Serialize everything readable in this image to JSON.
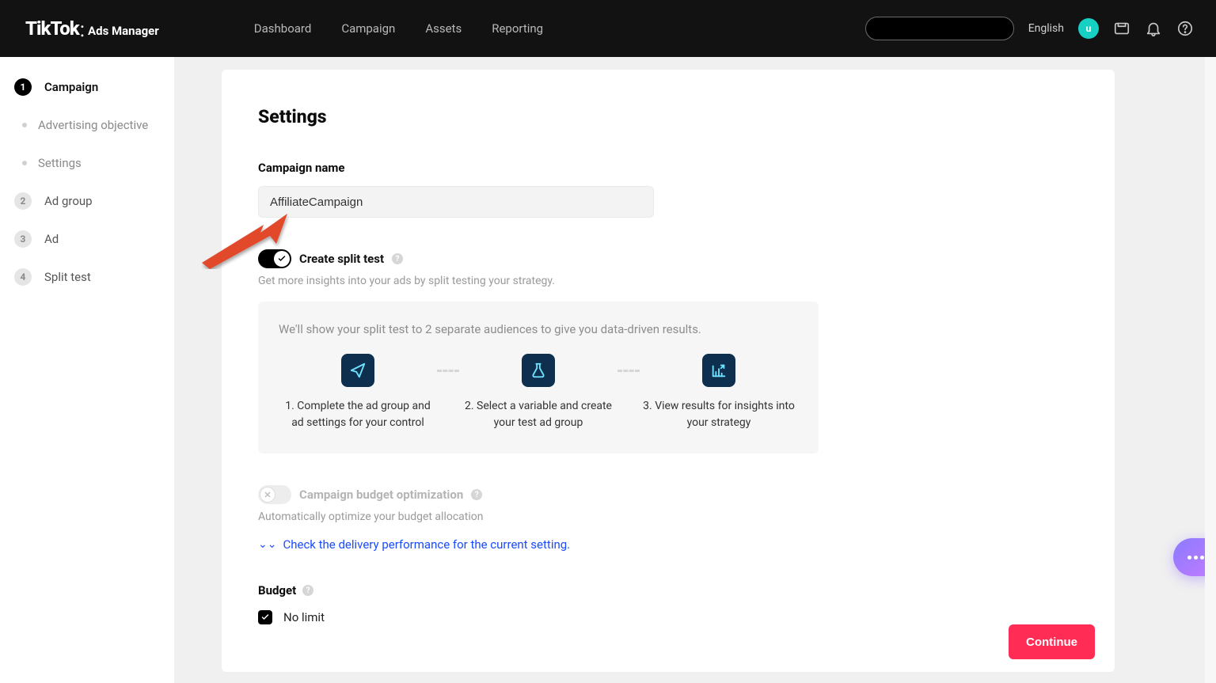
{
  "brand": {
    "name": "TikTok",
    "product": "Ads Manager"
  },
  "nav": {
    "dashboard": "Dashboard",
    "campaign": "Campaign",
    "assets": "Assets",
    "reporting": "Reporting",
    "language": "English",
    "avatar_initial": "u"
  },
  "sidebar": {
    "steps": [
      {
        "num": "1",
        "label": "Campaign",
        "active": true
      },
      {
        "num": "2",
        "label": "Ad group"
      },
      {
        "num": "3",
        "label": "Ad"
      },
      {
        "num": "4",
        "label": "Split test"
      }
    ],
    "campaign_substeps": {
      "advertising_objective": "Advertising objective",
      "settings": "Settings"
    }
  },
  "page": {
    "heading": "Settings",
    "campaign_name_label": "Campaign name",
    "campaign_name_value": "AffiliateCampaign",
    "split_test": {
      "label": "Create split test",
      "helper": "Get more insights into your ads by split testing your strategy.",
      "box_lead": "We'll show your split test to 2 separate audiences to give you data-driven results.",
      "step1": "1. Complete the ad group and ad settings for your control",
      "step2": "2. Select a variable and create your test ad group",
      "step3": "3. View results for insights into your strategy"
    },
    "cbo": {
      "label": "Campaign budget optimization",
      "helper": "Automatically optimize your budget allocation",
      "delivery_link": "Check the delivery performance for the current setting."
    },
    "budget": {
      "label": "Budget",
      "no_limit": "No limit"
    },
    "continue": "Continue"
  }
}
